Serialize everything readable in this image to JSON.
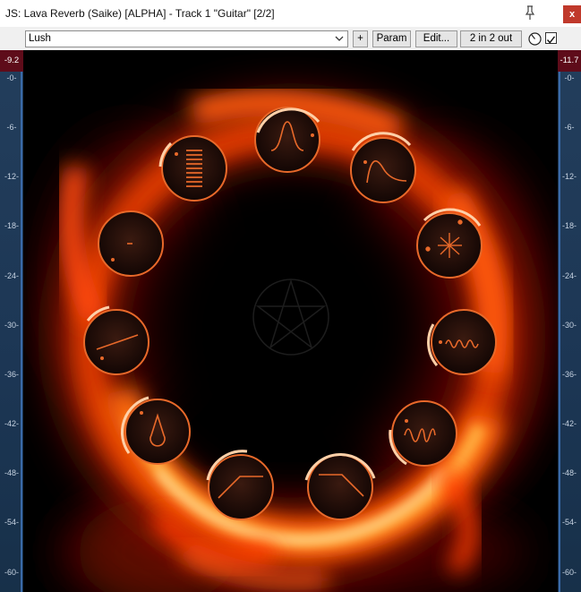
{
  "window": {
    "title": "JS: Lava Reverb (Saike) [ALPHA] - Track 1 \"Guitar\" [2/2]",
    "close_label": "x"
  },
  "toolbar": {
    "preset": "Lush",
    "plus_label": "+",
    "param_label": "Param",
    "edit_label": "Edit...",
    "io_label": "2 in 2 out",
    "bypass_checked": true
  },
  "meters": {
    "left_peak": "-9.2",
    "right_peak": "-11.7",
    "ticks": [
      "-0-",
      "-6-",
      "-12-",
      "-18-",
      "-24-",
      "-30-",
      "-36-",
      "-42-",
      "-48-",
      "-54-",
      "-60-"
    ]
  },
  "colors": {
    "knob_ring": "#ff7a1a",
    "lava_hot": "#ffd080",
    "lava_mid": "#ff4a0a",
    "lava_dark": "#7a1000",
    "meter_bg": "#1c3654",
    "peak_bg": "#5e0c1a"
  },
  "knobs": [
    {
      "name": "bell-curve-knob",
      "icon": "bell-curve-icon"
    },
    {
      "name": "decay-envelope-knob",
      "icon": "decay-envelope-icon"
    },
    {
      "name": "diffusion-knob",
      "icon": "burst-icon"
    },
    {
      "name": "modulation-knob",
      "icon": "wave-icon"
    },
    {
      "name": "chorus-knob",
      "icon": "oscillation-icon"
    },
    {
      "name": "highcut-knob",
      "icon": "high-cut-icon"
    },
    {
      "name": "lowcut-knob",
      "icon": "low-cut-icon"
    },
    {
      "name": "drip-knob",
      "icon": "drop-icon"
    },
    {
      "name": "width-knob",
      "icon": "slope-line-icon"
    },
    {
      "name": "dry-knob",
      "icon": "dash-icon"
    },
    {
      "name": "level-knob",
      "icon": "level-bars-icon"
    }
  ]
}
